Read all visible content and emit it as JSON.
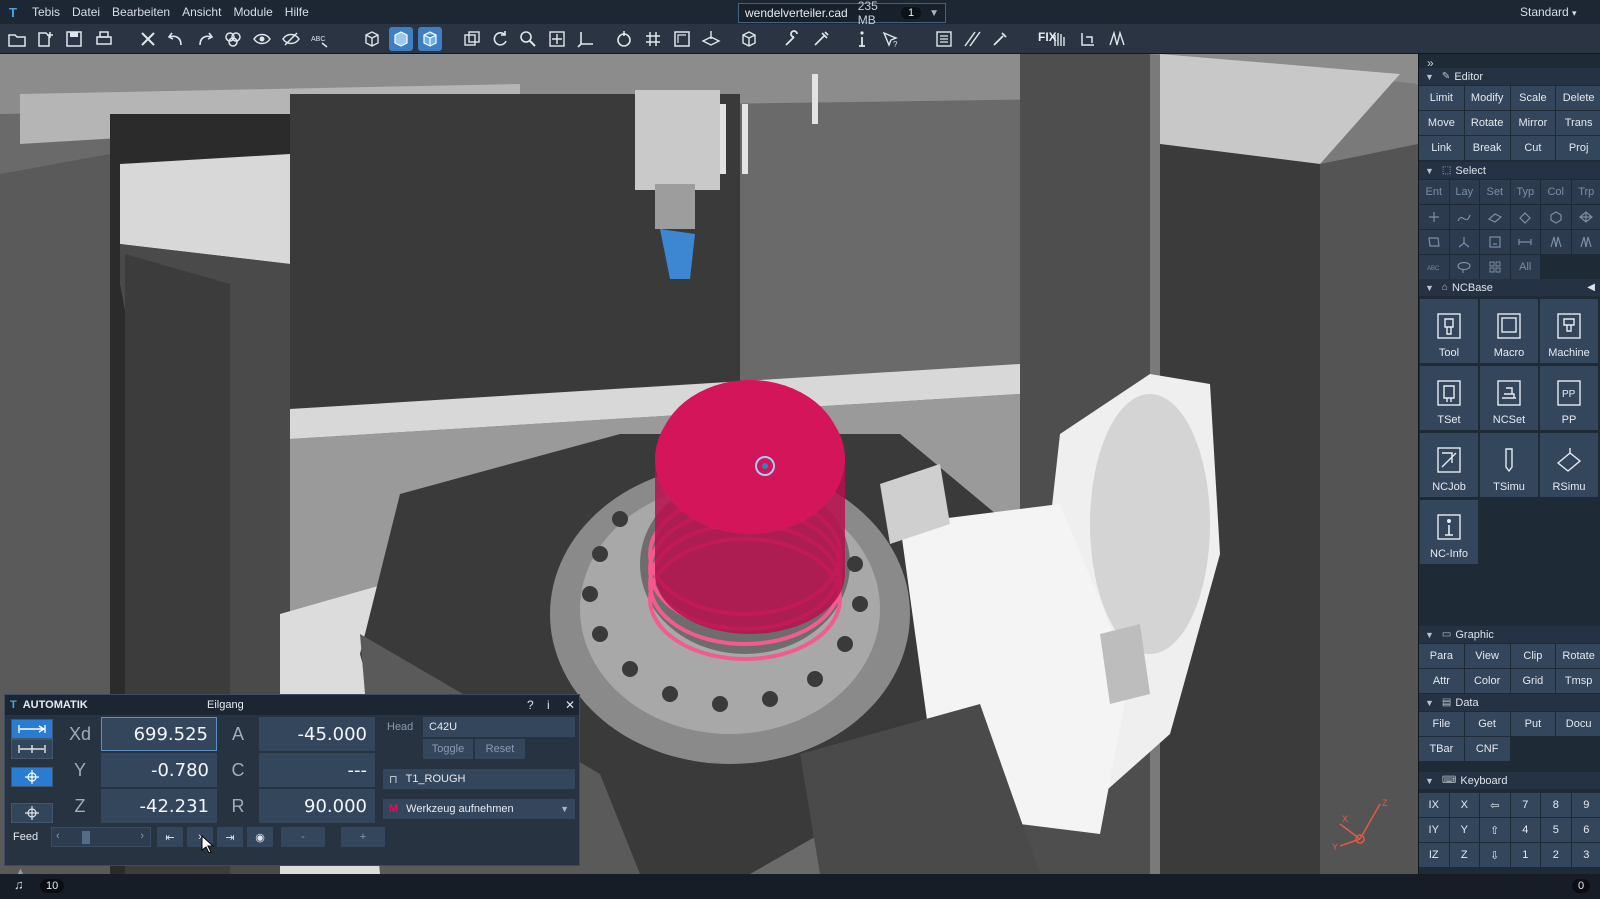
{
  "menu": {
    "items": [
      "Tebis",
      "Datei",
      "Bearbeiten",
      "Ansicht",
      "Module",
      "Hilfe"
    ]
  },
  "file": {
    "name": "wendelverteiler.cad",
    "size": "235 MB",
    "count": "1"
  },
  "layout_name": "Standard",
  "toolbar": {
    "fix_label": "FIX"
  },
  "editor": {
    "title": "Editor",
    "buttons": [
      "Limit",
      "Modify",
      "Scale",
      "Delete",
      "Move",
      "Rotate",
      "Mirror",
      "Trans",
      "Link",
      "Break",
      "Cut",
      "Proj"
    ]
  },
  "select": {
    "title": "Select",
    "filters": [
      "Ent",
      "Lay",
      "Set",
      "Typ",
      "Col",
      "Trp"
    ],
    "all_label": "All"
  },
  "ncbase": {
    "title": "NCBase",
    "buttons": [
      "Tool",
      "Macro",
      "Machine",
      "TSet",
      "NCSet",
      "PP",
      "NCJob",
      "TSimu",
      "RSimu",
      "NC-Info"
    ]
  },
  "graphic": {
    "title": "Graphic",
    "buttons": [
      "Para",
      "View",
      "Clip",
      "Rotate",
      "Attr",
      "Color",
      "Grid",
      "Tmsp"
    ]
  },
  "data_section": {
    "title": "Data",
    "buttons": [
      "File",
      "Get",
      "Put",
      "Docu",
      "TBar",
      "CNF"
    ]
  },
  "keyboard": {
    "title": "Keyboard",
    "keys": [
      "IX",
      "X",
      "⇦",
      "7",
      "8",
      "9",
      "IY",
      "Y",
      "⇧",
      "4",
      "5",
      "6",
      "IZ",
      "Z",
      "⇩",
      "1",
      "2",
      "3"
    ]
  },
  "dialog": {
    "title": "AUTOMATIK",
    "mode": "Eilgang",
    "help": "?",
    "info": "i",
    "close": "✕",
    "axes": [
      {
        "label": "Xd",
        "value": "699.525"
      },
      {
        "label": "Y",
        "value": "-0.780"
      },
      {
        "label": "Z",
        "value": "-42.231"
      }
    ],
    "rot_axes": [
      {
        "label": "A",
        "value": "-45.000"
      },
      {
        "label": "C",
        "value": "---"
      },
      {
        "label": "R",
        "value": "90.000"
      }
    ],
    "head_label": "Head",
    "head_value": "C42U",
    "toggle_label": "Toggle",
    "reset_label": "Reset",
    "tool_name": "T1_ROUGH",
    "action": "Werkzeug aufnehmen",
    "feed_label": "Feed",
    "minus": "-",
    "plus": "+"
  },
  "status": {
    "left_count": "10",
    "right_count": "0"
  },
  "colors": {
    "accent": "#2a7bd2",
    "part": "#d4155a",
    "panel": "#1f2a37"
  }
}
